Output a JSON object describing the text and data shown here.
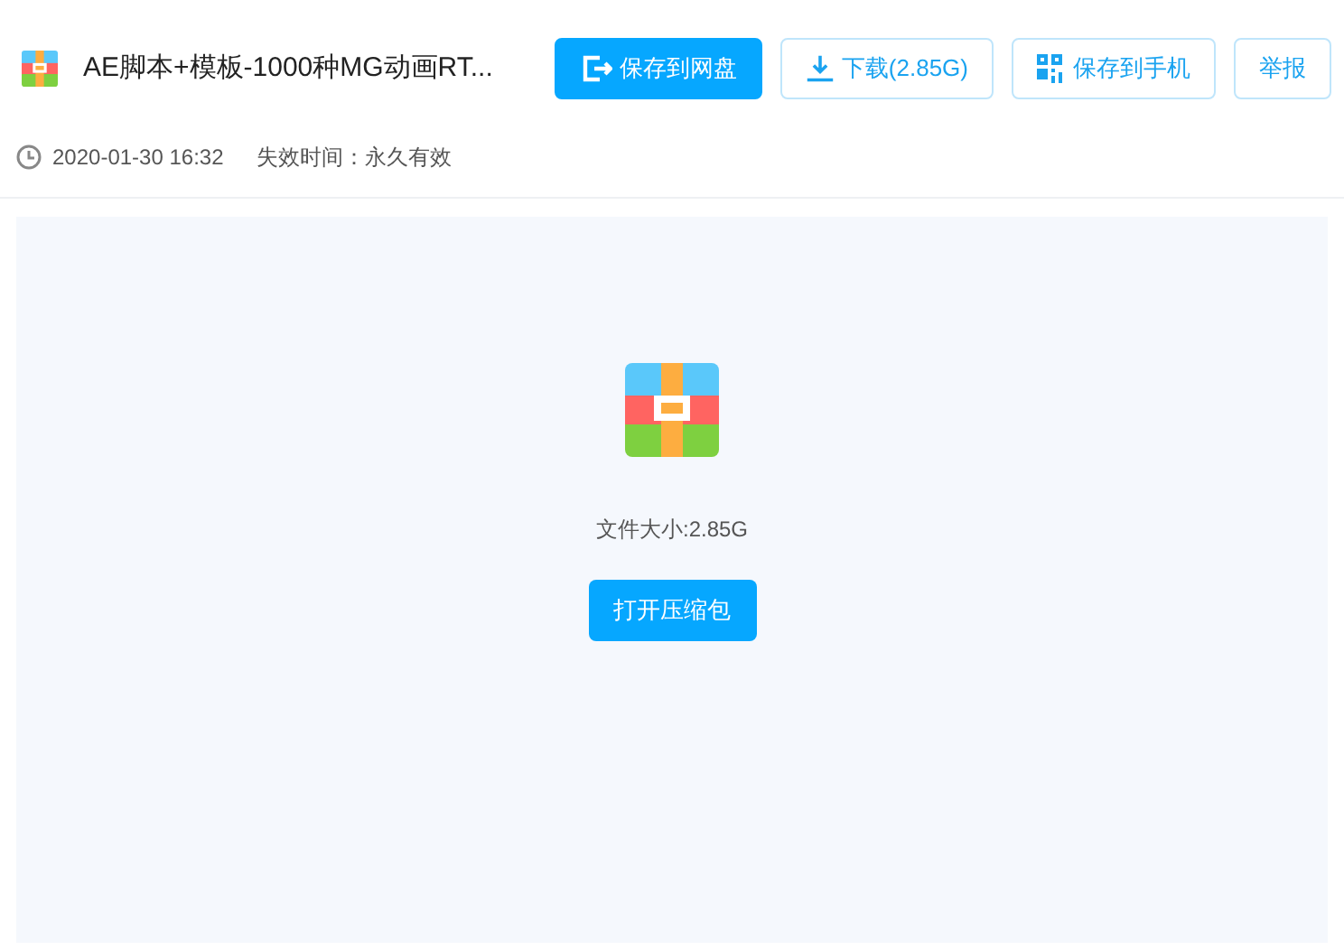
{
  "header": {
    "title": "AE脚本+模板-1000种MG动画RT...",
    "actions": [
      {
        "kind": "primary",
        "label": "保存到网盘"
      },
      {
        "kind": "outline",
        "label": "下载(2.85G)"
      },
      {
        "kind": "outline",
        "label": "保存到手机"
      },
      {
        "kind": "outline",
        "label": "举报"
      }
    ]
  },
  "meta": {
    "date": "2020-01-30 16:32",
    "expiry": "失效时间：永久有效"
  },
  "preview": {
    "size": "文件大小:2.85G",
    "open_button": "打开压缩包"
  }
}
